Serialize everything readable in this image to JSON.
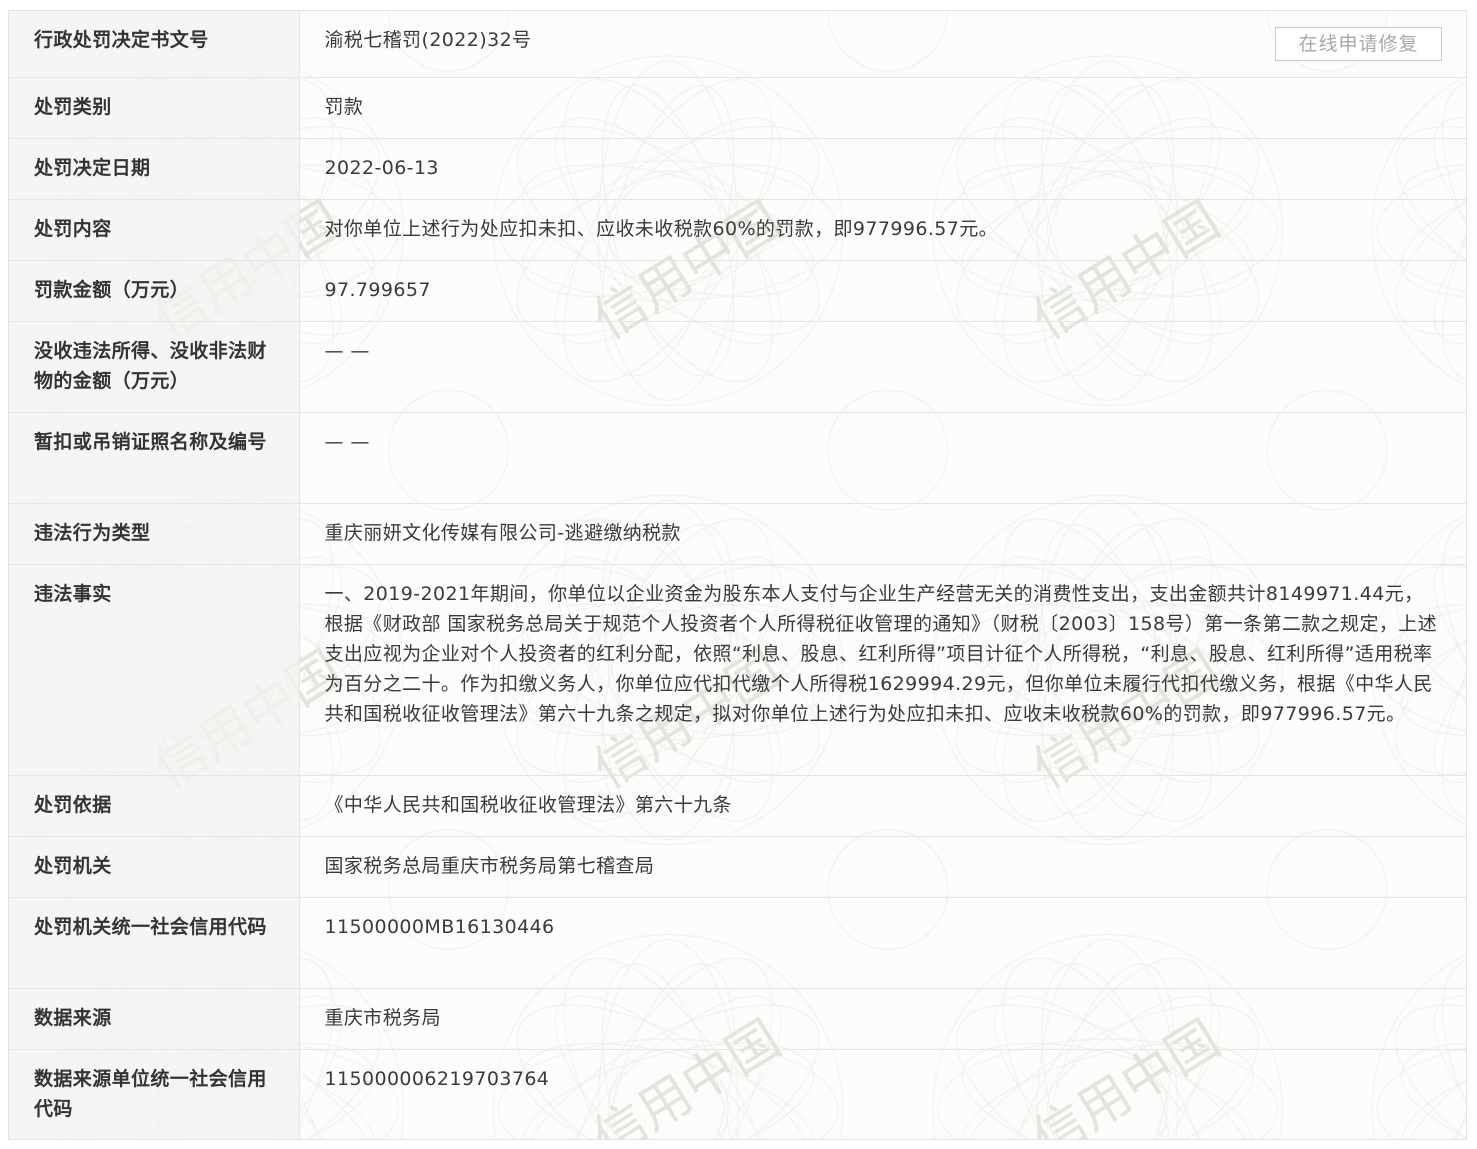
{
  "watermark": {
    "text": "信用中国",
    "color": "#d2d9cf"
  },
  "repair_button_label": "在线申请修复",
  "rows": [
    {
      "label": "行政处罚决定书文号",
      "value": "渝税七稽罚(2022)32号"
    },
    {
      "label": "处罚类别",
      "value": "罚款"
    },
    {
      "label": "处罚决定日期",
      "value": "2022-06-13"
    },
    {
      "label": "处罚内容",
      "value": "对你单位上述行为处应扣未扣、应收未收税款60%的罚款，即977996.57元。"
    },
    {
      "label": "罚款金额（万元）",
      "value": "97.799657"
    },
    {
      "label": "没收违法所得、没收非法财物的金额（万元）",
      "value": "— —"
    },
    {
      "label": "暂扣或吊销证照名称及编号",
      "value": "— —"
    },
    {
      "label": "违法行为类型",
      "value": "重庆丽妍文化传媒有限公司-逃避缴纳税款"
    },
    {
      "label": "违法事实",
      "value": "一、2019-2021年期间，你单位以企业资金为股东本人支付与企业生产经营无关的消费性支出，支出金额共计8149971.44元，根据《财政部 国家税务总局关于规范个人投资者个人所得税征收管理的通知》（财税〔2003〕158号）第一条第二款之规定，上述支出应视为企业对个人投资者的红利分配，依照“利息、股息、红利所得”项目计征个人所得税，“利息、股息、红利所得”适用税率为百分之二十。作为扣缴义务人，你单位应代扣代缴个人所得税1629994.29元，但你单位未履行代扣代缴义务，根据《中华人民共和国税收征收管理法》第六十九条之规定，拟对你单位上述行为处应扣未扣、应收未收税款60%的罚款，即977996.57元。"
    },
    {
      "label": "处罚依据",
      "value": "《中华人民共和国税收征收管理法》第六十九条"
    },
    {
      "label": "处罚机关",
      "value": "国家税务总局重庆市税务局第七稽查局"
    },
    {
      "label": "处罚机关统一社会信用代码",
      "value": "11500000MB16130446"
    },
    {
      "label": "数据来源",
      "value": "重庆市税务局"
    },
    {
      "label": "数据来源单位统一社会信用代码",
      "value": "115000006219703764"
    }
  ]
}
